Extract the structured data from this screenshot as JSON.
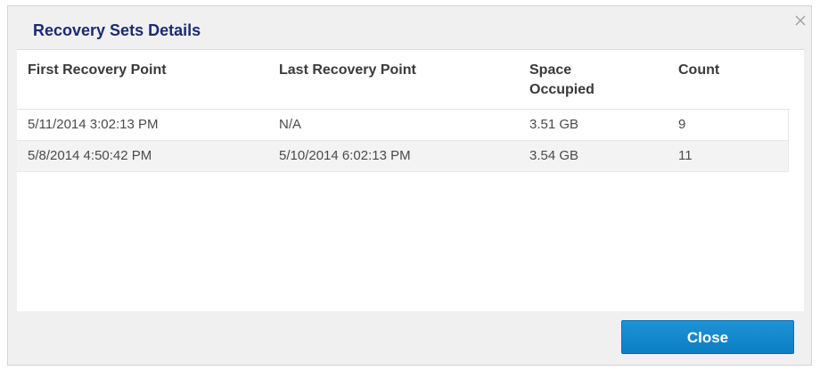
{
  "dialog": {
    "title": "Recovery Sets Details",
    "close_icon": "close-icon"
  },
  "table": {
    "headers": [
      "First Recovery Point",
      "Last Recovery Point",
      "Space\nOccupied",
      "Count"
    ],
    "rows": [
      [
        "5/11/2014 3:02:13 PM",
        "N/A",
        "3.51 GB",
        "9"
      ],
      [
        "5/8/2014 4:50:42 PM",
        "5/10/2014 6:02:13 PM",
        "3.54 GB",
        "11"
      ]
    ]
  },
  "footer": {
    "close_label": "Close"
  },
  "colors": {
    "title": "#1b2b73",
    "button": "#1589cf"
  }
}
